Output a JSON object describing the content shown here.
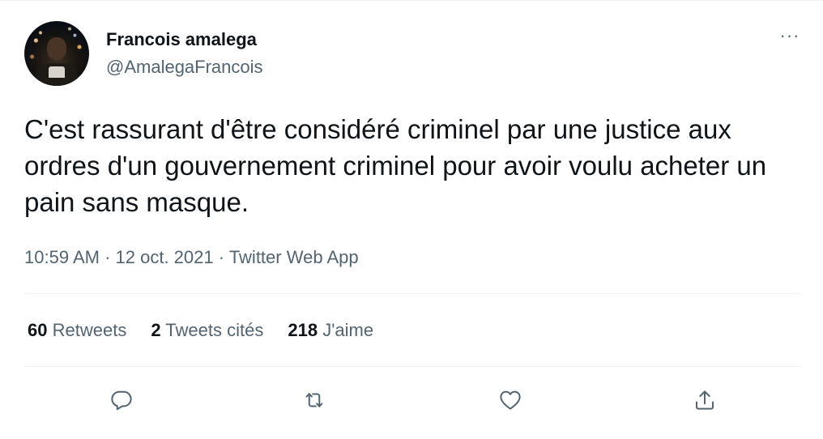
{
  "author": {
    "display_name": "Francois amalega",
    "handle": "@AmalegaFrancois"
  },
  "tweet": {
    "text": "C'est rassurant d'être considéré criminel par une justice aux ordres d'un gouvernement criminel pour avoir voulu acheter un pain sans masque.",
    "time": "10:59 AM",
    "date": "12 oct. 2021",
    "source": "Twitter Web App",
    "separator": "·"
  },
  "stats": {
    "retweets_count": "60",
    "retweets_label": "Retweets",
    "quotes_count": "2",
    "quotes_label": "Tweets cités",
    "likes_count": "218",
    "likes_label": "J'aime"
  },
  "menu": {
    "more_label": "···"
  },
  "actions": [
    {
      "name": "reply",
      "icon": "reply-icon"
    },
    {
      "name": "retweet",
      "icon": "retweet-icon"
    },
    {
      "name": "like",
      "icon": "heart-icon"
    },
    {
      "name": "share",
      "icon": "share-icon"
    }
  ],
  "colors": {
    "text_primary": "#0f1419",
    "text_secondary": "#536471",
    "divider": "#eff3f4"
  }
}
